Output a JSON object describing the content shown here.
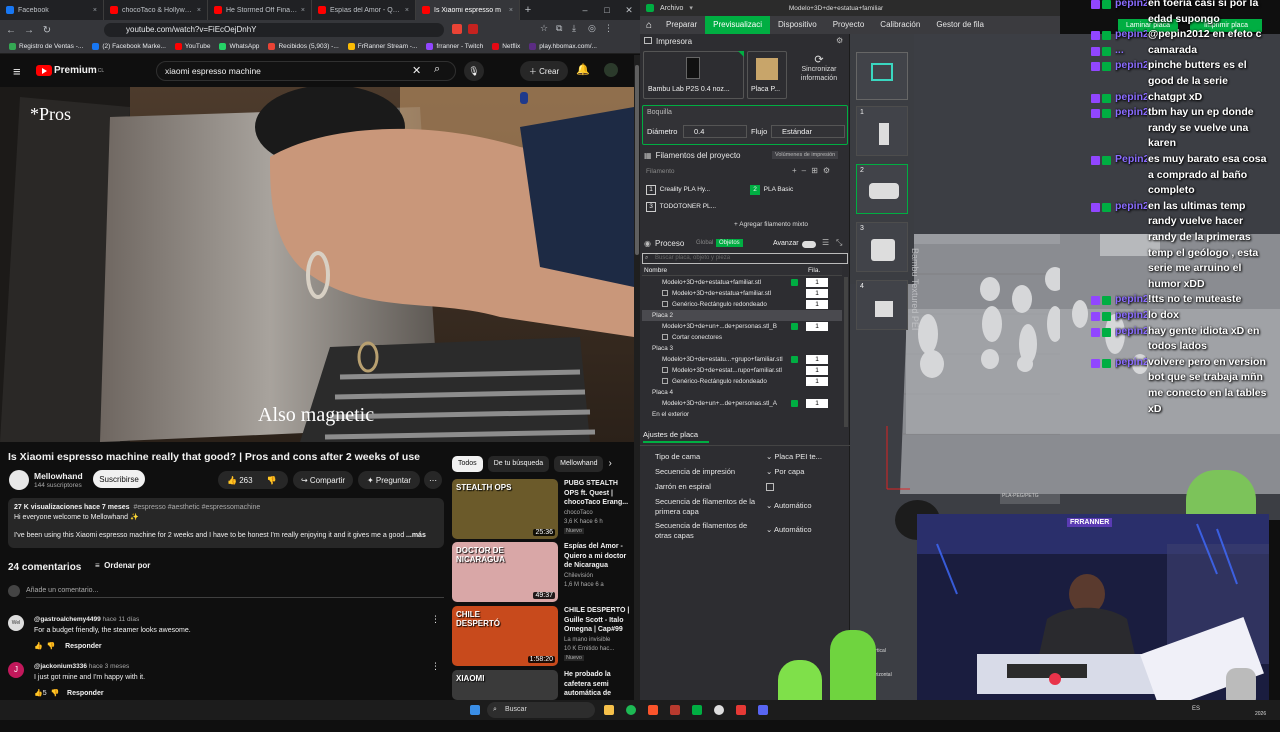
{
  "browser": {
    "tabs": [
      {
        "title": "Facebook",
        "color": "#1877f2"
      },
      {
        "title": "chocoTaco & HollywoodBob",
        "color": "#ff0000"
      },
      {
        "title": "He Stormed Off Financial Au",
        "color": "#ff0000"
      },
      {
        "title": "Espías del Amor - Quiero a m",
        "color": "#ff0000"
      },
      {
        "title": "Is Xiaomi espresso m",
        "color": "#ff0000",
        "active": true
      }
    ],
    "new_tab": "+",
    "url": "youtube.com/watch?v=FiEcOejDnhY",
    "bookmarks": [
      {
        "label": "Registro de Ventas -...",
        "color": "#34a853"
      },
      {
        "label": "(2) Facebook Marke...",
        "color": "#1877f2"
      },
      {
        "label": "YouTube",
        "color": "#ff0000"
      },
      {
        "label": "WhatsApp",
        "color": "#25d366"
      },
      {
        "label": "Recibidos (5,903) -...",
        "color": "#ea4335"
      },
      {
        "label": "FrRanner Stream -...",
        "color": "#fbbc04"
      },
      {
        "label": "frranner - Twitch",
        "color": "#9146ff"
      },
      {
        "label": "Netflix",
        "color": "#e50914"
      },
      {
        "label": "play.hbomax.com/...",
        "color": "#5b2c83"
      }
    ]
  },
  "youtube": {
    "logo": "Premium",
    "logo_sup": "CL",
    "search_value": "xiaomi espresso machine",
    "create_label": "Crear",
    "video": {
      "caption_top": "*Pros",
      "caption_bottom": "Also magnetic"
    },
    "title": "Is Xiaomi espresso machine really that good? | Pros and cons after 2 weeks of use",
    "channel": {
      "name": "Mellowhand",
      "subs": "144 suscriptores"
    },
    "subscribe_label": "Suscribirse",
    "likes": "263",
    "share_label": "Compartir",
    "ask_label": "Preguntar",
    "description": {
      "stats": "27 K visualizaciones  hace 7 meses",
      "tags": "#espresso #aesthetic #espressomachine",
      "line1": "Hi everyone welcome to Mellowhand ✨",
      "line2": "I've been using this Xiaomi espresso machine for 2 weeks and I have to be honest I'm really enjoying it and it gives me a good sho",
      "more": "...más"
    },
    "comments": {
      "count": "24 comentarios",
      "sort_label": "Ordenar por",
      "add_placeholder": "Añade un comentario...",
      "items": [
        {
          "author": "@gastroalchemy4499",
          "time": "hace 11 días",
          "text": "For a budget friendly, the steamer looks awesome.",
          "reply": "Responder"
        },
        {
          "author": "@jackonium3336",
          "time": "hace 3 meses",
          "text": "I just got mine and I'm happy with it.",
          "likes": "5",
          "reply": "Responder"
        }
      ]
    },
    "chips": [
      "Todos",
      "De tu búsqueda",
      "Mellowhand"
    ],
    "related": [
      {
        "title": "PUBG STEALTH OPS ft. Quest | chocoTaco Erang...",
        "channel": "chocoTaco",
        "meta": "3,6 K  hace 6 h",
        "badge": "Nuevo",
        "duration": "25:36",
        "thumb_text": "STEALTH OPS",
        "color": "#6b5a2a"
      },
      {
        "title": "Espías del Amor - Quiero a mi doctor de Nicaragua",
        "channel": "Chilevisión",
        "meta": "1,6 M  hace 6 a",
        "duration": "49:37",
        "thumb_text": "DOCTOR DE NICARAGUA",
        "color": "#d9a7a7"
      },
      {
        "title": "CHILE DESPERTÓ | Guille Scott - Italo Omegna | Cap#99",
        "channel": "La mano invisible",
        "meta": "10 K  Emitido hac...",
        "badge": "Nuevo",
        "duration": "1:58:20",
        "thumb_text": "CHILE DESPERTÓ",
        "color": "#c84a1c"
      },
      {
        "title": "He probado la cafetera semi automática de",
        "channel": "",
        "meta": "",
        "duration": "",
        "thumb_text": "XIAOMI",
        "color": "#3a3a3a"
      }
    ]
  },
  "bambu": {
    "menu_file": "Archivo",
    "window_title": "Modelo+3D+de+estatua+familiar",
    "nav": [
      "Preparar",
      "Previsualizaci",
      "Dispositivo",
      "Proyecto",
      "Calibración",
      "Gestor de fila"
    ],
    "nav_active": 1,
    "printer_section": "Impresora",
    "printer_name": "Bambu Lab P2S 0.4 noz...",
    "plate_name": "Placa P...",
    "sync_label": "Sincronizar información",
    "nozzle_section": "Boquilla",
    "diameter_label": "Diámetro",
    "diameter_value": "0.4",
    "flow_label": "Flujo",
    "flow_value": "Estándar",
    "filaments_section": "Filamentos del proyecto",
    "volumes_btn": "Volúmenes de impresión",
    "filament_label": "Filamento",
    "filaments": [
      {
        "num": "1",
        "name": "Creality PLA Hy..."
      },
      {
        "num": "2",
        "name": "PLA Basic"
      },
      {
        "num": "3",
        "name": "TODOTONER PL..."
      }
    ],
    "add_filament": "+ Agregar filamento mixto",
    "process_section": "Proceso",
    "process_global": "Global",
    "process_objects": "Objetos",
    "advanced_label": "Avanzar",
    "search_placeholder": "Buscar placa, objeto y pieza",
    "col_name": "Nombre",
    "col_fil": "Fila.",
    "tree": [
      {
        "text": "Modelo+3D+de+estatua+familiar.stl",
        "indent": 1,
        "check": true,
        "fil": "1"
      },
      {
        "text": "Modelo+3D+de+estatua+familiar.stl",
        "indent": 2,
        "fil": "1"
      },
      {
        "text": "Genérico-Rectángulo redondeado",
        "indent": 2,
        "fil": "1"
      },
      {
        "text": "Placa 2",
        "indent": 0,
        "highlight": true
      },
      {
        "text": "Modelo+3D+de+un+...de+personas.stl_B",
        "indent": 1,
        "check": true,
        "fil": "1"
      },
      {
        "text": "Cortar conectores",
        "indent": 2
      },
      {
        "text": "Placa 3",
        "indent": 0
      },
      {
        "text": "Modelo+3D+de+estatu...+grupo+familiar.stl",
        "indent": 1,
        "check": true,
        "fil": "1"
      },
      {
        "text": "Modelo+3D+de+estat...rupo+familiar.stl",
        "indent": 2,
        "fil": "1"
      },
      {
        "text": "Genérico-Rectángulo redondeado",
        "indent": 2,
        "fil": "1"
      },
      {
        "text": "Placa 4",
        "indent": 0
      },
      {
        "text": "Modelo+3D+de+un+...de+personas.stl_A",
        "indent": 1,
        "check": true,
        "fil": "1"
      },
      {
        "text": "En el exterior",
        "indent": 0
      }
    ],
    "plate_settings": "Ajustes de placa",
    "settings": [
      {
        "label": "Tipo de cama",
        "value": "Placa PEI te..."
      },
      {
        "label": "Secuencia de impresión",
        "value": "Por capa"
      },
      {
        "label": "Jarrón en espiral",
        "value": ""
      },
      {
        "label": "Secuencia de filamentos de la primera capa",
        "value": "Automático"
      },
      {
        "label": "Secuencia de filamentos de otras capas",
        "value": "Automático"
      }
    ],
    "plate_numbers": [
      "1",
      "2",
      "3",
      "4"
    ],
    "slice_btn": "Laminar placa",
    "print_btn": "Imprimir placa",
    "vp_side_text": "Bambu Textured PEI",
    "plate_label": "PLA-PEG/PETG"
  },
  "chat": [
    {
      "user": "pepin20...",
      "text": "en toeria casi si por la"
    },
    {
      "text": "edad supongo"
    },
    {
      "user": "pepin2012",
      "text": "@pepin2012 en efeto c"
    },
    {
      "user": "...",
      "text": "camarada"
    },
    {
      "user": "pepin20...",
      "text": "pinche butters es el"
    },
    {
      "text": "good de la serie"
    },
    {
      "user": "pepin20...",
      "text": "chatgpt xD"
    },
    {
      "user": "pepin20...",
      "text": "tbm hay un ep donde"
    },
    {
      "text": "randy se vuelve una"
    },
    {
      "text": "karen"
    },
    {
      "user": "Pepin20...",
      "text": "es muy barato esa cosa"
    },
    {
      "text": "a comprado al baño"
    },
    {
      "text": "completo"
    },
    {
      "user": "pepin20...",
      "text": "en las ultimas temp"
    },
    {
      "text": "randy vuelve hacer"
    },
    {
      "text": "randy de la primeras"
    },
    {
      "text": "temp el geólogo , esta"
    },
    {
      "text": "serie me arruino el"
    },
    {
      "text": "humor xDD"
    },
    {
      "user": "pepin20...",
      "text": "!tts no te muteaste"
    },
    {
      "user": "pepin20...",
      "text": "lo dox"
    },
    {
      "user": "pepin20...",
      "text": "hay gente idiota xD en"
    },
    {
      "text": "todos lados"
    },
    {
      "user": "pepin20...",
      "text": "volvere pero en version"
    },
    {
      "text": "bot que se trabaja mñn"
    },
    {
      "text": "me conecto en la tables"
    },
    {
      "text": "xD"
    }
  ],
  "webcam": {
    "overlay_name": "FRRANNER",
    "side_label_1": "vertical",
    "side_label_2": "horizontal"
  },
  "taskbar": {
    "search_placeholder": "Buscar",
    "lang": "ES",
    "year": "2026"
  }
}
